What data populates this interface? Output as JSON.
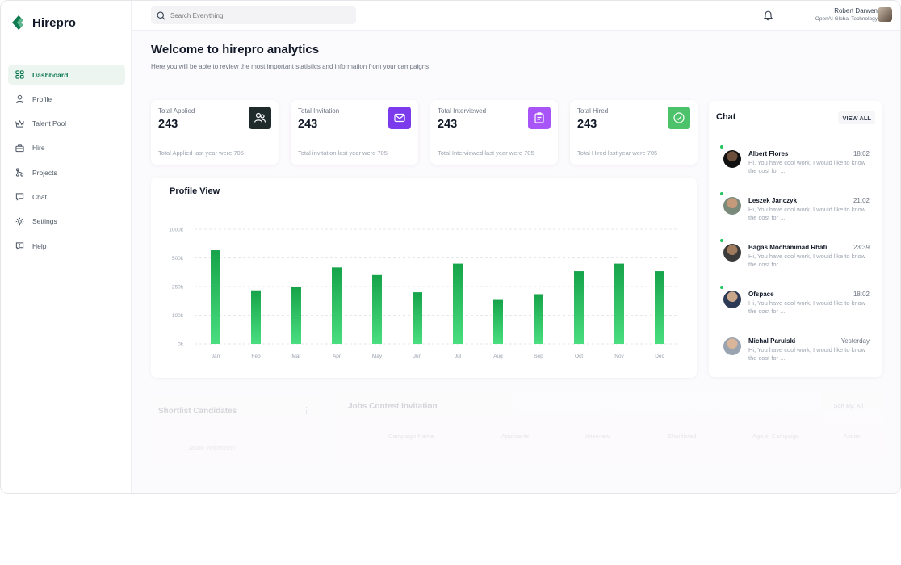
{
  "brand": {
    "name": "Hirepro",
    "color": "#0f7a4f"
  },
  "nav": [
    {
      "label": "Dashboard",
      "icon": "dashboard-icon",
      "active": true
    },
    {
      "label": "Profile",
      "icon": "user-icon"
    },
    {
      "label": "Talent Pool",
      "icon": "crown-icon"
    },
    {
      "label": "Hire",
      "icon": "briefcase-icon"
    },
    {
      "label": "Projects",
      "icon": "git-branch-icon"
    },
    {
      "label": "Chat",
      "icon": "chat-bubble-icon"
    },
    {
      "label": "Settings",
      "icon": "gear-icon"
    },
    {
      "label": "Help",
      "icon": "help-icon"
    }
  ],
  "search": {
    "placeholder": "Search Everything"
  },
  "user": {
    "name": "Robert Darwen",
    "org": "OpenAI Global Technology"
  },
  "welcome": {
    "title": "Welcome to hirepro analytics",
    "subtitle": "Here you will be able to review the most important statistics and information from your campaigns"
  },
  "stats": [
    {
      "title": "Total Applied",
      "value": "243",
      "footer": "Total Applied last year were 705",
      "color": "#1f2a2a"
    },
    {
      "title": "Total Invitation",
      "value": "243",
      "footer": "Total invitation last year were 705",
      "color": "#7c3aed"
    },
    {
      "title": "Total Interviewed",
      "value": "243",
      "footer": "Total Interviewed last year were 705",
      "color": "#a855f7"
    },
    {
      "title": "Total Hired",
      "value": "243",
      "footer": "Total Hired last year were 705",
      "color": "#4cc26a"
    }
  ],
  "chart_data": {
    "type": "bar",
    "title": "Profile View",
    "categories": [
      "Jan",
      "Feb",
      "Mar",
      "Apr",
      "May",
      "Jun",
      "Jul",
      "Aug",
      "Sep",
      "Oct",
      "Nov",
      "Dec"
    ],
    "values": [
      490,
      280,
      300,
      400,
      360,
      270,
      420,
      230,
      260,
      380,
      420,
      380
    ],
    "yticks": [
      "0k",
      "100k",
      "250k",
      "500k",
      "1000k"
    ],
    "ylabel": "",
    "xlabel": "",
    "ylim": [
      0,
      600
    ],
    "grid": true,
    "bar_color": "#16a34a"
  },
  "chat": {
    "title": "Chat",
    "view_all": "VIEW ALL",
    "messages": [
      {
        "name": "Albert Flores",
        "time": "18:02",
        "text": "Hi, You have cool work, I would like to know the cost for ...",
        "online": true
      },
      {
        "name": "Leszek Janczyk",
        "time": "21:02",
        "text": "Hi, You have cool work, I would like to know the cost for ...",
        "online": true
      },
      {
        "name": "Bagas Mochammad Rhafi",
        "time": "23:39",
        "text": "Hi, You have cool work, I would like to know the cost for ...",
        "online": true
      },
      {
        "name": "Ofspace",
        "time": "18:02",
        "text": "Hi, You have cool work, I would like to know the cost for ...",
        "online": true
      },
      {
        "name": "Michal Parulski",
        "time": "Yesterday",
        "text": "Hi, You have cool work, I would like to know the cost for ...",
        "online": false
      }
    ]
  },
  "shortlist": {
    "title": "Shortlist Candidates",
    "candidate": "Jason Williamson"
  },
  "jobs": {
    "title": "Jobs Contest Invitation",
    "sort": "Sort By: All",
    "columns": [
      "Campaign Name",
      "Applicants",
      "Interview",
      "Shortlisted",
      "Age of Campaign",
      "Action"
    ]
  }
}
